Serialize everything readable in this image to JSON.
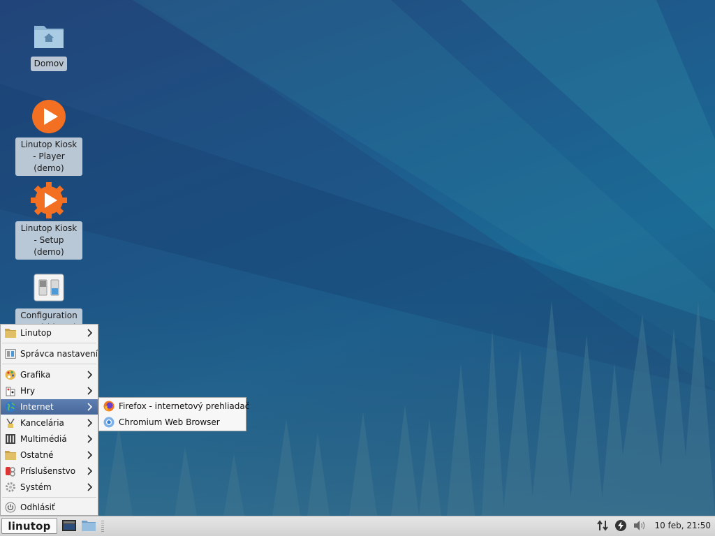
{
  "desktop": {
    "icons": [
      {
        "label": "Domov",
        "icon": "home-folder-icon"
      },
      {
        "label": "Linutop Kiosk - Player (demo)",
        "icon": "play-icon"
      },
      {
        "label": "Linutop Kiosk - Setup (demo)",
        "icon": "gear-play-icon"
      },
      {
        "label": "Configuration Panel (demo)",
        "icon": "toggle-panel-icon"
      }
    ]
  },
  "menu": {
    "items": [
      {
        "label": "Linutop",
        "icon": "folder-icon",
        "submenu": true
      },
      {
        "label": "Správca nastavení",
        "icon": "settings-manager-icon",
        "submenu": false
      },
      {
        "label": "Grafika",
        "icon": "palette-icon",
        "submenu": true
      },
      {
        "label": "Hry",
        "icon": "game-icon",
        "submenu": true
      },
      {
        "label": "Internet",
        "icon": "globe-icon",
        "submenu": true,
        "active": true
      },
      {
        "label": "Kancelária",
        "icon": "office-icon",
        "submenu": true
      },
      {
        "label": "Multimédiá",
        "icon": "multimedia-icon",
        "submenu": true
      },
      {
        "label": "Ostatné",
        "icon": "folder-icon",
        "submenu": true
      },
      {
        "label": "Príslušenstvo",
        "icon": "accessories-icon",
        "submenu": true
      },
      {
        "label": "Systém",
        "icon": "gear-icon",
        "submenu": true
      },
      {
        "label": "Odhlásiť",
        "icon": "power-icon",
        "submenu": false
      }
    ],
    "submenu": [
      {
        "label": "Firefox - internetový prehliadač",
        "icon": "firefox-icon"
      },
      {
        "label": "Chromium Web Browser",
        "icon": "chromium-icon"
      }
    ]
  },
  "panel": {
    "start_label": "linutop",
    "clock": "10 feb, 21:50"
  },
  "colors": {
    "menu_highlight": "#5272a6",
    "accent_orange": "#f36f21"
  }
}
